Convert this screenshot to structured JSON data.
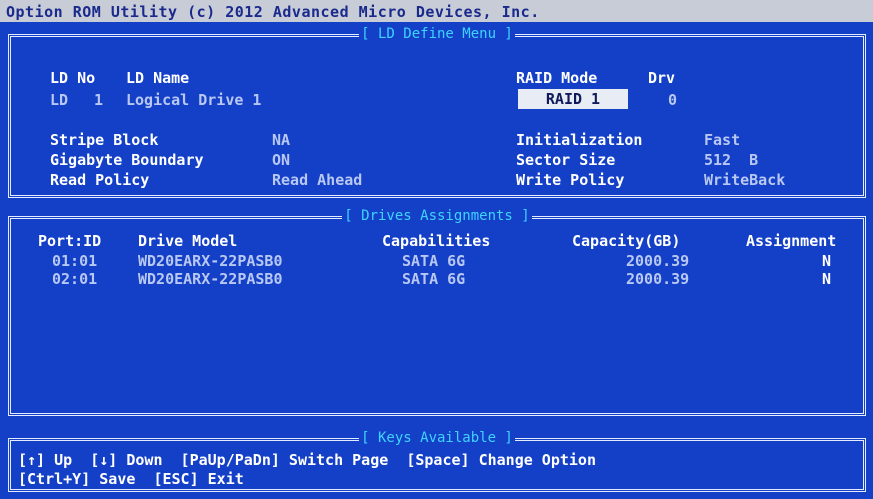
{
  "title": "Option ROM Utility (c) 2012 Advanced Micro Devices, Inc.",
  "ld_panel": {
    "title": "[ LD Define Menu ]",
    "ld_no_header": "LD No",
    "ld_name_header": "LD Name",
    "ld_prefix": "LD",
    "ld_no": "1",
    "ld_name": "Logical Drive 1",
    "raid_mode_header": "RAID Mode",
    "drv_header": "Drv",
    "raid_mode": "RAID 1",
    "drv": "0",
    "stripe_block_label": "Stripe Block",
    "stripe_block": "NA",
    "gigabyte_boundary_label": "Gigabyte Boundary",
    "gigabyte_boundary": "ON",
    "read_policy_label": "Read Policy",
    "read_policy": "Read Ahead",
    "initialization_label": "Initialization",
    "initialization": "Fast",
    "sector_size_label": "Sector Size",
    "sector_size": "512  B",
    "write_policy_label": "Write Policy",
    "write_policy": "WriteBack"
  },
  "drives_panel": {
    "title": "[ Drives Assignments ]",
    "headers": {
      "port": "Port:ID",
      "model": "Drive Model",
      "capabilities": "Capabilities",
      "capacity": "Capacity(GB)",
      "assignment": "Assignment"
    },
    "rows": [
      {
        "port": "01:01",
        "model": "WD20EARX-22PASB0",
        "capabilities": "SATA 6G",
        "capacity": "2000.39",
        "assignment": "N"
      },
      {
        "port": "02:01",
        "model": "WD20EARX-22PASB0",
        "capabilities": "SATA 6G",
        "capacity": "2000.39",
        "assignment": "N"
      }
    ]
  },
  "keys_panel": {
    "title": "[ Keys Available ]",
    "line1": "[↑] Up  [↓] Down  [PaUp/PaDn] Switch Page  [Space] Change Option",
    "line2": "[Ctrl+Y] Save  [ESC] Exit"
  },
  "colors": {
    "background": "#1440c8",
    "panel_title": "#3fd3ff",
    "header_text": "#ffffff",
    "value_text": "#b9c8f2",
    "title_bar": "#c8ccd6"
  }
}
